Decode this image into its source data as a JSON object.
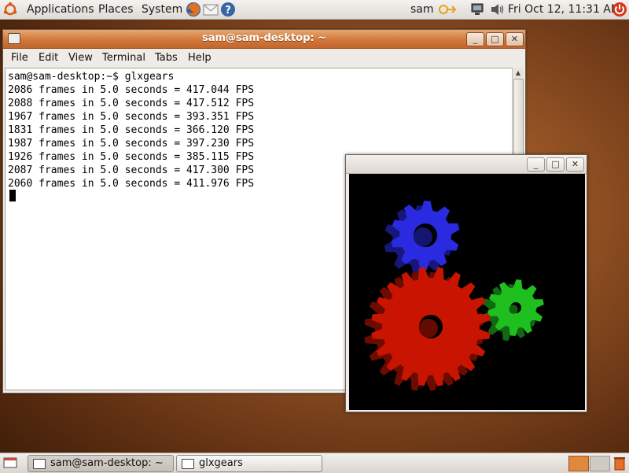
{
  "top_panel": {
    "menus": [
      "Applications",
      "Places",
      "System"
    ],
    "user": "sam",
    "clock": "Fri Oct 12, 11:31 AM",
    "icons": [
      "ubuntu-logo-icon",
      "firefox-icon",
      "mail-icon",
      "help-icon",
      "user-switch-icon",
      "network-icon",
      "volume-icon",
      "power-icon"
    ]
  },
  "terminal": {
    "title": "sam@sam-desktop: ~",
    "menu": [
      "File",
      "Edit",
      "View",
      "Terminal",
      "Tabs",
      "Help"
    ],
    "lines": [
      "sam@sam-desktop:~$ glxgears",
      "2086 frames in 5.0 seconds = 417.044 FPS",
      "2088 frames in 5.0 seconds = 417.512 FPS",
      "1967 frames in 5.0 seconds = 393.351 FPS",
      "1831 frames in 5.0 seconds = 366.120 FPS",
      "1987 frames in 5.0 seconds = 397.230 FPS",
      "1926 frames in 5.0 seconds = 385.115 FPS",
      "2087 frames in 5.0 seconds = 417.300 FPS",
      "2060 frames in 5.0 seconds = 411.976 FPS"
    ]
  },
  "gears_window": {
    "gear_colors": {
      "red": "#c81400",
      "green": "#1fbf1f",
      "blue": "#2a2ae0"
    }
  },
  "bottom_panel": {
    "tasks": [
      "sam@sam-desktop: ~",
      "glxgears"
    ]
  },
  "colors": {
    "titlebar_active": "#d2783c",
    "desktop": "#8f4f22"
  }
}
